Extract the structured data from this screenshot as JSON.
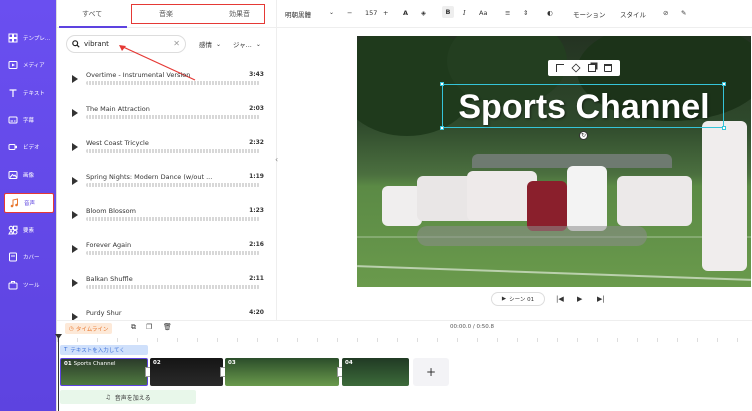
{
  "sidebar": {
    "items": [
      {
        "label": "テンプレ..."
      },
      {
        "label": "メディア"
      },
      {
        "label": "テキスト"
      },
      {
        "label": "字幕"
      },
      {
        "label": "ビデオ"
      },
      {
        "label": "画像"
      },
      {
        "label": "音声"
      },
      {
        "label": "要素"
      },
      {
        "label": "カバー"
      },
      {
        "label": "ツール"
      }
    ],
    "active": "音声",
    "accent": "#5d43e0"
  },
  "panel": {
    "tabs": {
      "all": "すべて",
      "music": "音楽",
      "sfx": "効果音"
    },
    "search": {
      "value": "vibrant"
    },
    "filters": {
      "mood": "感情",
      "genre": "ジャ..."
    },
    "tracks": [
      {
        "title": "Overtime - Instrumental Version",
        "duration": "3:43"
      },
      {
        "title": "The Main Attraction",
        "duration": "2:03"
      },
      {
        "title": "West Coast Tricycle",
        "duration": "2:32"
      },
      {
        "title": "Spring Nights: Modern Dance (w/out ...",
        "duration": "1:19"
      },
      {
        "title": "Bloom Blossom",
        "duration": "1:23"
      },
      {
        "title": "Forever Again",
        "duration": "2:16"
      },
      {
        "title": "Balkan Shuffle",
        "duration": "2:11"
      },
      {
        "title": "Purdy Shur",
        "duration": "4:20"
      }
    ]
  },
  "toolbar": {
    "font": "明朝黒體",
    "font_size": "157",
    "motion": "モーション",
    "style": "スタイル"
  },
  "canvas": {
    "title_text": "Sports Channel",
    "scene_label": "シーン 01",
    "selection_color": "#35c4d8"
  },
  "timeline": {
    "label": "タイムライン",
    "time": "00:00.0 / 0:50.8",
    "text_track": "テキストを入力してく",
    "clips": [
      {
        "num": "01",
        "label": "Sports Channel"
      },
      {
        "num": "02"
      },
      {
        "num": "03"
      },
      {
        "num": "04"
      }
    ],
    "audio_label": "音声を加える"
  }
}
